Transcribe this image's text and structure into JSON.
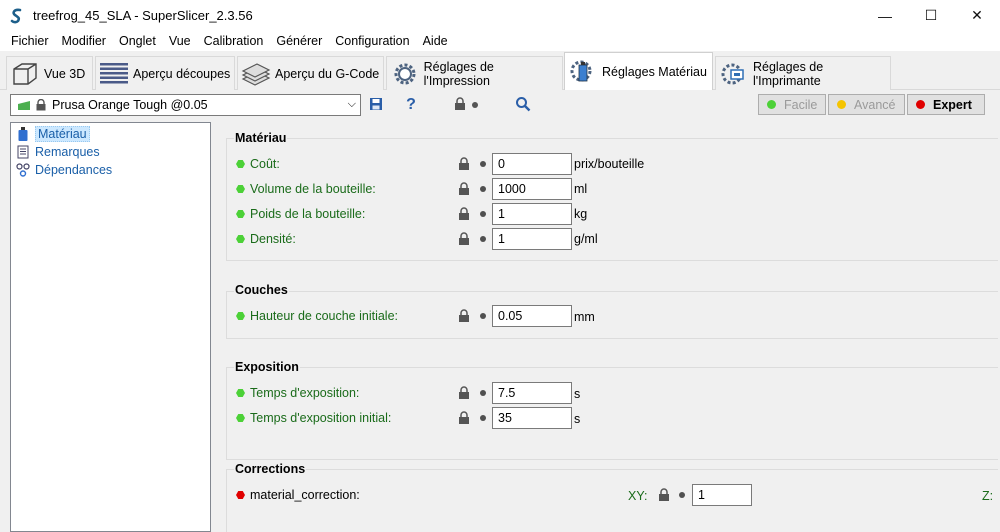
{
  "window": {
    "title": "treefrog_45_SLA - SuperSlicer_2.3.56",
    "minimize": "—",
    "maximize": "☐",
    "close": "✕"
  },
  "menu": [
    "Fichier",
    "Modifier",
    "Onglet",
    "Vue",
    "Calibration",
    "Générer",
    "Configuration",
    "Aide"
  ],
  "tabs": [
    {
      "label": "Vue 3D",
      "icon": "cube-icon"
    },
    {
      "label": "Aperçu découpes",
      "icon": "layers-icon"
    },
    {
      "label": "Aperçu du G-Code",
      "icon": "gcode-stack-icon"
    },
    {
      "label": "Réglages de l'Impression",
      "icon": "gear-icon"
    },
    {
      "label": "Réglages Matériau",
      "icon": "resin-gear-icon"
    },
    {
      "label": "Réglages de l'Imprimante",
      "icon": "printer-gear-icon"
    }
  ],
  "preset": {
    "name": "Prusa Orange Tough @0.05"
  },
  "modes": {
    "simple": "Facile",
    "advanced": "Avancé",
    "expert": "Expert"
  },
  "tree": [
    {
      "label": "Matériau",
      "icon": "bottle-icon"
    },
    {
      "label": "Remarques",
      "icon": "notes-icon"
    },
    {
      "label": "Dépendances",
      "icon": "dependencies-icon"
    }
  ],
  "groups": {
    "materiau": {
      "title": "Matériau",
      "options": [
        {
          "label": "Coût:",
          "value": "0",
          "unit": "prix/bouteille"
        },
        {
          "label": "Volume de la bouteille:",
          "value": "1000",
          "unit": "ml"
        },
        {
          "label": "Poids de la bouteille:",
          "value": "1",
          "unit": "kg"
        },
        {
          "label": "Densité:",
          "value": "1",
          "unit": "g/ml"
        }
      ]
    },
    "couches": {
      "title": "Couches",
      "options": [
        {
          "label": "Hauteur de couche initiale:",
          "value": "0.05",
          "unit": "mm"
        }
      ]
    },
    "exposition": {
      "title": "Exposition",
      "options": [
        {
          "label": "Temps d'exposition:",
          "value": "7.5",
          "unit": "s"
        },
        {
          "label": "Temps d'exposition initial:",
          "value": "35",
          "unit": "s"
        }
      ]
    },
    "corrections": {
      "title": "Corrections",
      "label": "material_correction:",
      "xy_label": "XY:",
      "xy_value": "1",
      "z_label": "Z:"
    }
  },
  "colors": {
    "label_green": "#1a6b1a",
    "simple_dot": "#4cd137",
    "advanced_dot": "#f5c400",
    "expert_dot": "#e00000",
    "tree_blue": "#1a5fa8"
  }
}
